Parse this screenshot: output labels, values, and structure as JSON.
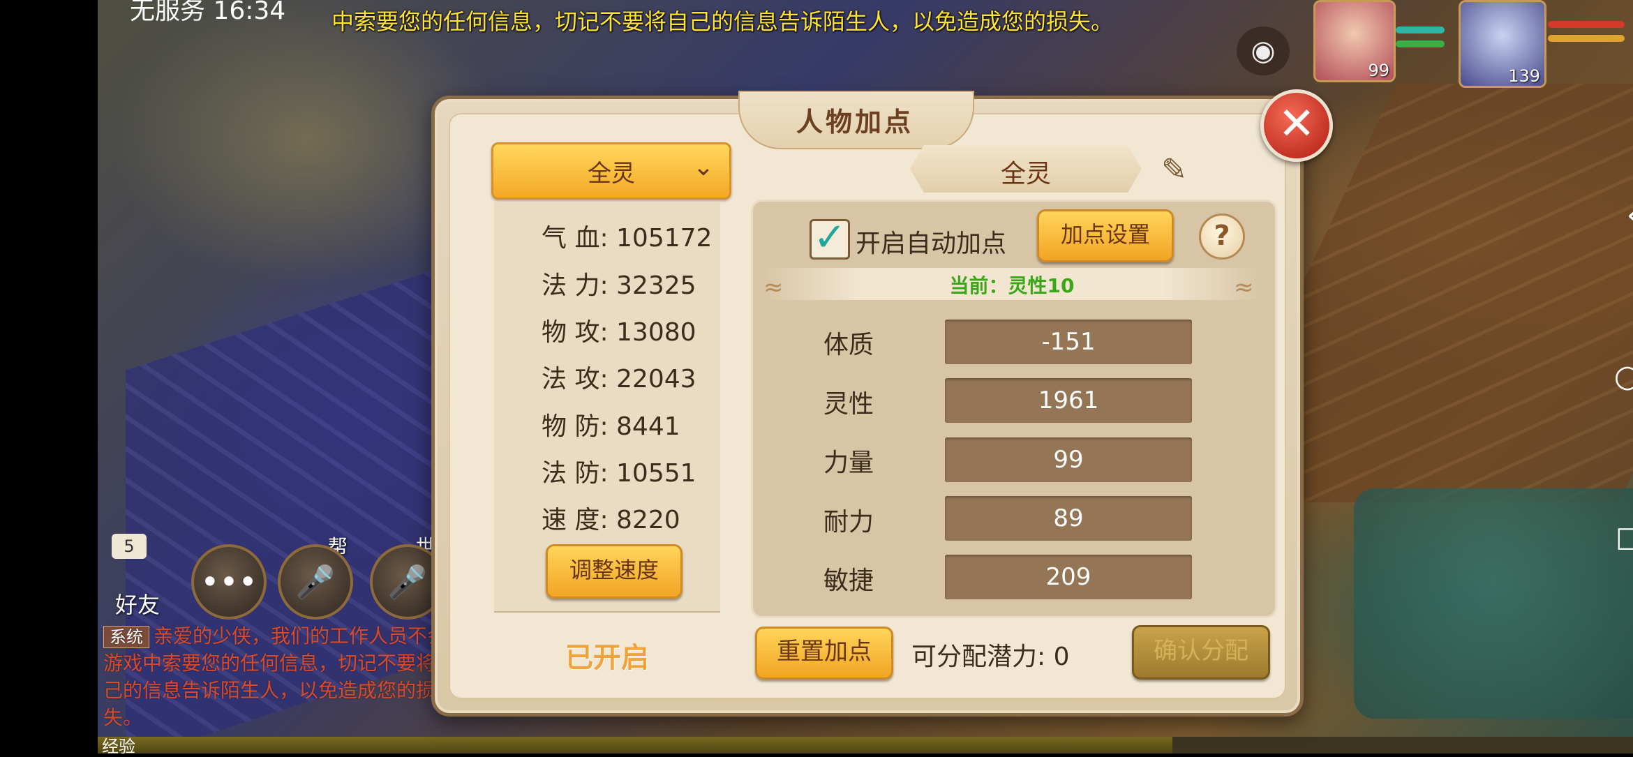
{
  "status_bar": {
    "carrier": "无服务",
    "time": "16:34"
  },
  "marquee": "中索要您的任何信息，切记不要将自己的信息告诉陌生人，以免造成您的损失。",
  "players": [
    {
      "level": "99"
    },
    {
      "level": "139"
    }
  ],
  "left_ui": {
    "friend_badge": "5",
    "friend_label": "好友",
    "guild_label": "帮",
    "world_label": "世",
    "chat_tag": "系统",
    "chat_text": "亲爱的少侠，我们的工作人员不会在游戏中索要您的任何信息，切记不要将自己的信息告诉陌生人，以免造成您的损失。",
    "exp_label": "经验"
  },
  "dialog": {
    "title": "人物加点",
    "scheme_dropdown": "全灵",
    "scheme_tab": "全灵",
    "stats": [
      {
        "label": "气 血:",
        "value": "105172"
      },
      {
        "label": "法 力:",
        "value": "32325"
      },
      {
        "label": "物 攻:",
        "value": "13080"
      },
      {
        "label": "法 攻:",
        "value": "22043"
      },
      {
        "label": "物 防:",
        "value": "8441"
      },
      {
        "label": "法 防:",
        "value": "10551"
      },
      {
        "label": "速 度:",
        "value": "8220"
      }
    ],
    "adjust_speed_button": "调整速度",
    "enabled_text": "已开启",
    "auto_add_label": "开启自动加点",
    "auto_add_checked": true,
    "settings_button": "加点设置",
    "help_icon": "?",
    "current_text": "当前：灵性10",
    "attributes": [
      {
        "label": "体质",
        "value": "-151"
      },
      {
        "label": "灵性",
        "value": "1961"
      },
      {
        "label": "力量",
        "value": "99"
      },
      {
        "label": "耐力",
        "value": "89"
      },
      {
        "label": "敏捷",
        "value": "209"
      }
    ],
    "reset_button": "重置加点",
    "potential_label": "可分配潜力:",
    "potential_value": "0",
    "confirm_button": "确认分配"
  },
  "colors": {
    "button_gold": "#f2a424",
    "button_disabled": "#9d7a2e",
    "current_green": "#3aa619",
    "close_red": "#b01c12"
  },
  "icons": {
    "camera": "camera-icon",
    "close": "close-icon",
    "pencil": "pencil-icon",
    "help": "help-icon",
    "chevron": "chevron-down-icon",
    "chat": "chat-bubble-icon",
    "mic": "mic-icon"
  }
}
